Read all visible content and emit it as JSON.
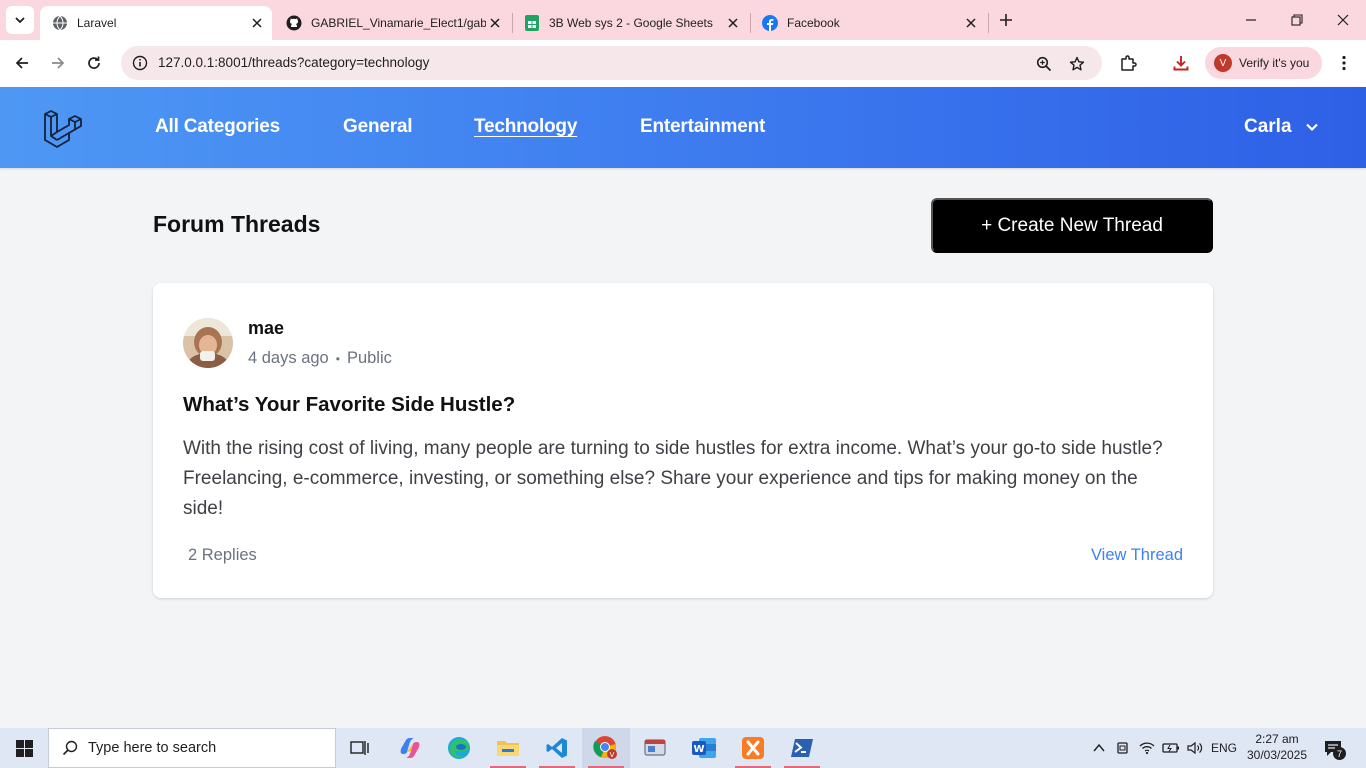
{
  "browser": {
    "tabs": [
      {
        "title": "Laravel",
        "icon": "globe-icon",
        "active": true
      },
      {
        "title": "GABRIEL_Vinamarie_Elect1/gab",
        "icon": "github-icon",
        "active": false
      },
      {
        "title": "3B Web sys 2 - Google Sheets",
        "icon": "google-sheets-icon",
        "active": false
      },
      {
        "title": "Facebook",
        "icon": "facebook-icon",
        "active": false
      }
    ],
    "url": "127.0.0.1:8001/threads?category=technology",
    "profile_initial": "V",
    "verify_label": "Verify it's you",
    "accent_color": "#fbd7df"
  },
  "navbar": {
    "links": [
      {
        "label": "All Categories"
      },
      {
        "label": "General"
      },
      {
        "label": "Technology",
        "current": true
      },
      {
        "label": "Entertainment"
      }
    ],
    "user_name": "Carla",
    "gradient_colors": [
      "#4e98f4",
      "#2e60e6"
    ]
  },
  "main": {
    "title": "Forum Threads",
    "create_button": "+ Create New Thread"
  },
  "thread": {
    "author": "mae",
    "time": "4 days ago",
    "separator": "•",
    "visibility": "Public",
    "title": "What’s Your Favorite Side Hustle?",
    "body": "With the rising cost of living, many people are turning to side hustles for extra income. What’s your go-to side hustle? Freelancing, e-commerce, investing, or something else? Share your experience and tips for making money on the side!",
    "replies": "2 Replies",
    "view_link": "View Thread",
    "link_color": "#3b82f6"
  },
  "taskbar": {
    "search_placeholder": "Type here to search",
    "language": "ENG",
    "time": "2:27 am",
    "date": "30/03/2025",
    "notification_count": "7"
  }
}
